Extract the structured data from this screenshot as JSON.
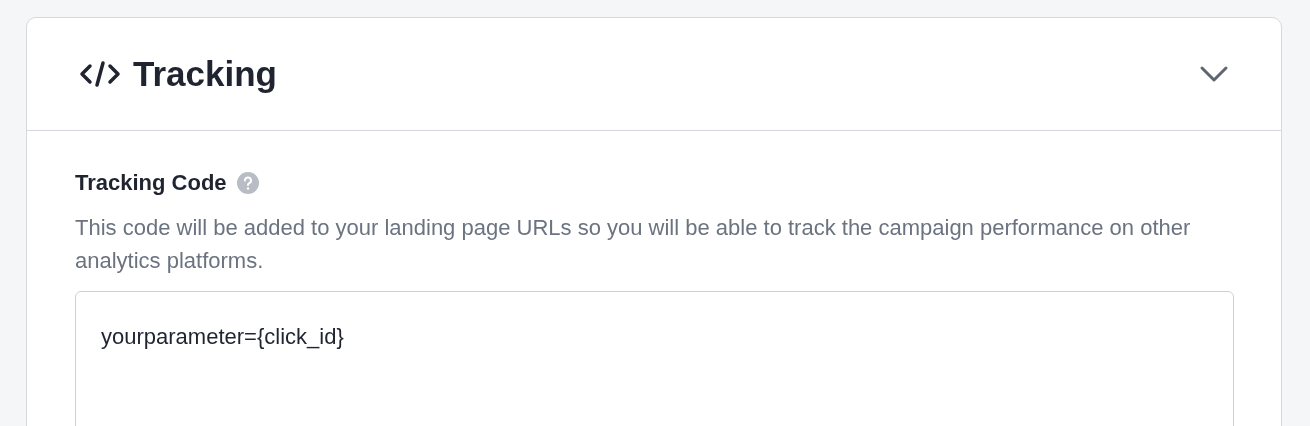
{
  "section": {
    "title": "Tracking",
    "expanded": true,
    "field": {
      "label": "Tracking Code",
      "description": "This code will be added to your landing page URLs so you will be able to track the campaign performance on other analytics platforms.",
      "value": "yourparameter={click_id}"
    }
  }
}
